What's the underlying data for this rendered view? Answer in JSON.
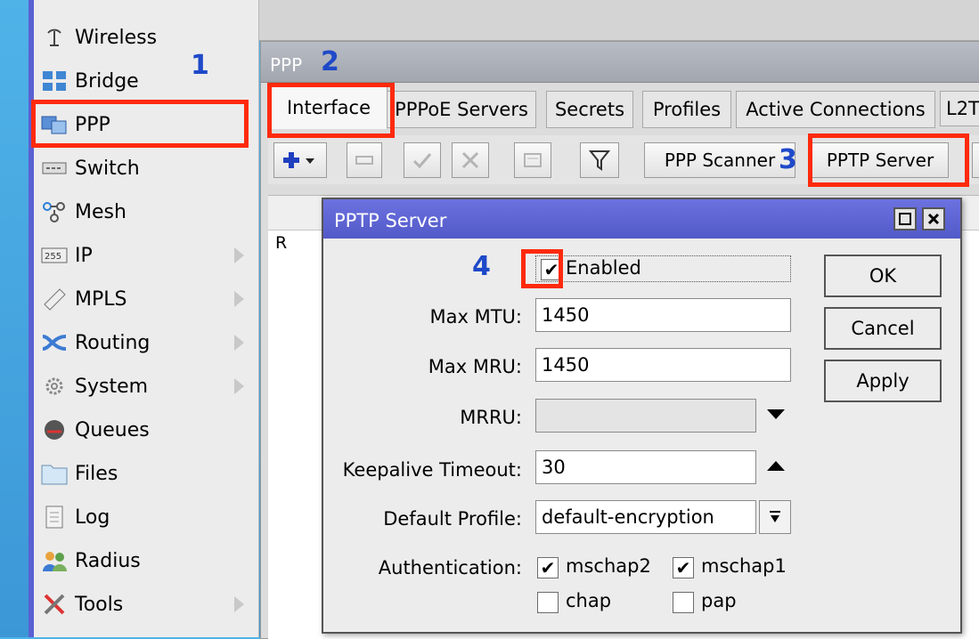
{
  "sidebar": {
    "items": [
      {
        "label": "Wireless",
        "icon": "wireless-icon",
        "submenu": false
      },
      {
        "label": "Bridge",
        "icon": "bridge-icon",
        "submenu": false
      },
      {
        "label": "PPP",
        "icon": "ppp-icon",
        "submenu": false
      },
      {
        "label": "Switch",
        "icon": "switch-icon",
        "submenu": false
      },
      {
        "label": "Mesh",
        "icon": "mesh-icon",
        "submenu": false
      },
      {
        "label": "IP",
        "icon": "ip-icon",
        "submenu": true
      },
      {
        "label": "MPLS",
        "icon": "mpls-icon",
        "submenu": true
      },
      {
        "label": "Routing",
        "icon": "routing-icon",
        "submenu": true
      },
      {
        "label": "System",
        "icon": "system-icon",
        "submenu": true
      },
      {
        "label": "Queues",
        "icon": "queues-icon",
        "submenu": false
      },
      {
        "label": "Files",
        "icon": "files-icon",
        "submenu": false
      },
      {
        "label": "Log",
        "icon": "log-icon",
        "submenu": false
      },
      {
        "label": "Radius",
        "icon": "radius-icon",
        "submenu": false
      },
      {
        "label": "Tools",
        "icon": "tools-icon",
        "submenu": true
      }
    ]
  },
  "annotations": {
    "step1": "1",
    "step2": "2",
    "step3": "3",
    "step4": "4",
    "color": "#ff2a0c",
    "number_color": "#1e49c8"
  },
  "ppp_window": {
    "title": "PPP",
    "tabs": [
      "Interface",
      "PPPoE Servers",
      "Secrets",
      "Profiles",
      "Active Connections",
      "L2T"
    ],
    "toolbar": {
      "scanner_label": "PPP Scanner",
      "pptp_label": "PPTP Server"
    },
    "list": {
      "row_flag": "R"
    }
  },
  "dialog": {
    "title": "PPTP Server",
    "enabled_label": "Enabled",
    "enabled_checked": true,
    "fields": {
      "max_mtu": {
        "label": "Max MTU:",
        "value": "1450"
      },
      "max_mru": {
        "label": "Max MRU:",
        "value": "1450"
      },
      "mrru": {
        "label": "MRRU:",
        "value": ""
      },
      "keepalive": {
        "label": "Keepalive Timeout:",
        "value": "30"
      },
      "default_profile": {
        "label": "Default Profile:",
        "value": "default-encryption"
      },
      "authentication": {
        "label": "Authentication:"
      }
    },
    "auth": [
      {
        "label": "mschap2",
        "checked": true
      },
      {
        "label": "mschap1",
        "checked": true
      },
      {
        "label": "chap",
        "checked": false
      },
      {
        "label": "pap",
        "checked": false
      }
    ],
    "buttons": {
      "ok": "OK",
      "cancel": "Cancel",
      "apply": "Apply"
    },
    "check_mark": "✔",
    "title_color": "#5a61d2"
  }
}
